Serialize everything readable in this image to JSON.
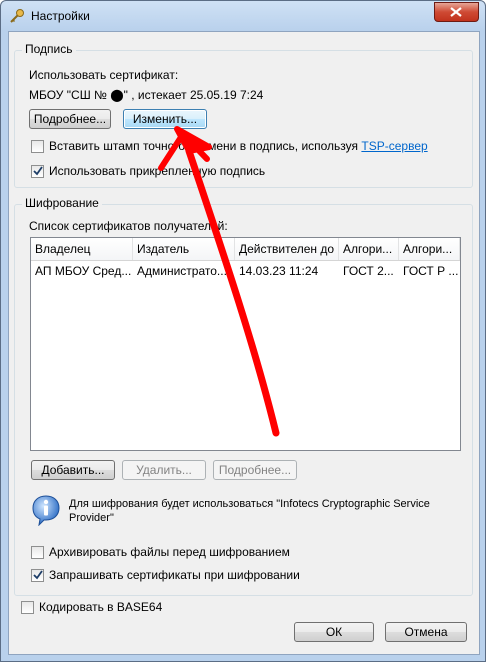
{
  "window": {
    "title": "Настройки"
  },
  "signature": {
    "group_title": "Подпись",
    "use_cert_label": "Использовать сертификат:",
    "cert_text": "МБОУ \"СШ № ⬤\" , истекает 25.05.19 7:24",
    "details_button": "Подробнее...",
    "change_button": "Изменить...",
    "timestamp_label": "Вставить штамп точного времени в подпись, используя",
    "tsp_link": "TSP-сервер",
    "timestamp_checked": false,
    "attached_label": "Использовать прикрепленную подпись",
    "attached_checked": true
  },
  "encryption": {
    "group_title": "Шифрование",
    "recipients_label": "Список сертификатов получателей:",
    "columns": [
      "Владелец",
      "Издатель",
      "Действителен до",
      "Алгори...",
      "Алгори..."
    ],
    "rows": [
      {
        "owner": "АП МБОУ Сред...",
        "issuer": "Администрато...",
        "valid_to": "14.03.23 11:24",
        "alg1": "ГОСТ 2...",
        "alg2": "ГОСТ Р ..."
      }
    ],
    "add_button": "Добавить...",
    "delete_button": "Удалить...",
    "details_button": "Подробнее...",
    "info_text_line1": "Для шифрования будет использоваться \"Infotecs Cryptographic Service",
    "info_text_line2": "Provider\"",
    "archive_label": "Архивировать файлы перед шифрованием",
    "archive_checked": false,
    "ask_certs_label": "Запрашивать сертификаты при шифровании",
    "ask_certs_checked": true
  },
  "base64_label": "Кодировать в BASE64",
  "base64_checked": false,
  "ok_button": "ОК",
  "cancel_button": "Отмена",
  "colors": {
    "arrow": "#ff0000",
    "link": "#0066cc"
  }
}
